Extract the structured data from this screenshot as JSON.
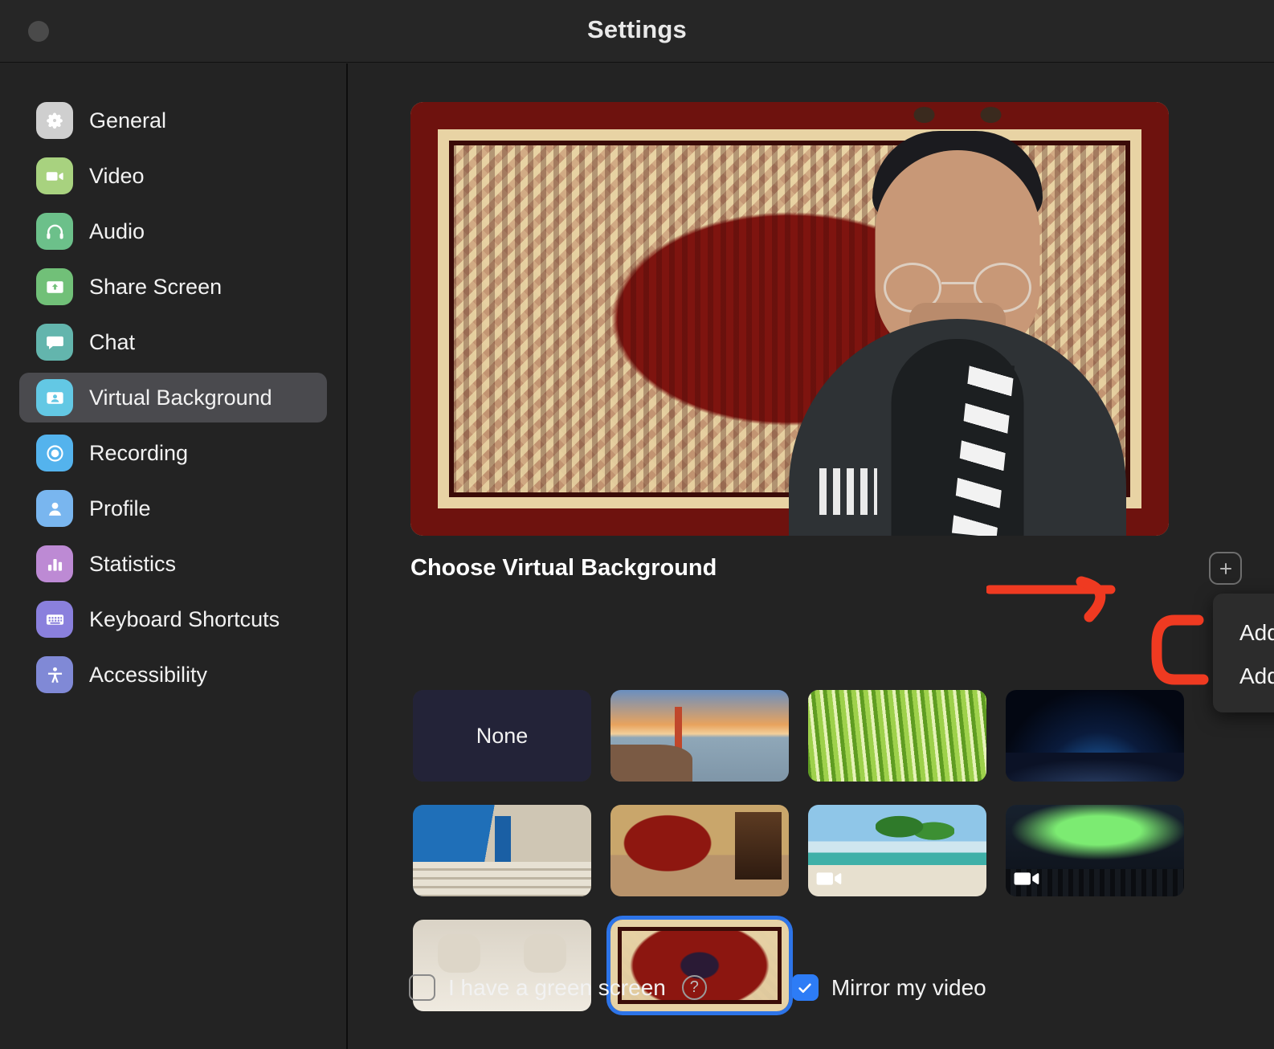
{
  "window": {
    "title": "Settings",
    "close_button": "close-window"
  },
  "sidebar": {
    "items": [
      {
        "label": "General",
        "icon": "gear-icon",
        "color": "#cfcfcf",
        "active": false
      },
      {
        "label": "Video",
        "icon": "video-camera-icon",
        "color": "#a8d27f",
        "active": false
      },
      {
        "label": "Audio",
        "icon": "headphones-icon",
        "color": "#6cc08a",
        "active": false
      },
      {
        "label": "Share Screen",
        "icon": "share-screen-icon",
        "color": "#71c078",
        "active": false
      },
      {
        "label": "Chat",
        "icon": "chat-bubble-icon",
        "color": "#63b5ad",
        "active": false
      },
      {
        "label": "Virtual Background",
        "icon": "person-card-icon",
        "color": "#63c8e4",
        "active": true
      },
      {
        "label": "Recording",
        "icon": "record-circle-icon",
        "color": "#54b3ed",
        "active": false
      },
      {
        "label": "Profile",
        "icon": "person-icon",
        "color": "#79b6ef",
        "active": false
      },
      {
        "label": "Statistics",
        "icon": "bar-chart-icon",
        "color": "#bd8ad4",
        "active": false
      },
      {
        "label": "Keyboard Shortcuts",
        "icon": "keyboard-icon",
        "color": "#8a80dd",
        "active": false
      },
      {
        "label": "Accessibility",
        "icon": "accessibility-icon",
        "color": "#8089d6",
        "active": false
      }
    ]
  },
  "main": {
    "preview_alt": "video-preview-with-carpet-background",
    "section_title": "Choose Virtual Background",
    "add_button_icon": "plus-icon",
    "dropdown": {
      "items": [
        "Add Image",
        "Add Video"
      ]
    },
    "backgrounds": [
      {
        "label": "None",
        "art": "a-none",
        "video": false,
        "selected": false
      },
      {
        "label": "",
        "art": "a-bridge",
        "video": false,
        "selected": false
      },
      {
        "label": "",
        "art": "a-grass",
        "video": false,
        "selected": false
      },
      {
        "label": "",
        "art": "a-space",
        "video": false,
        "selected": false
      },
      {
        "label": "",
        "art": "a-stairs",
        "video": false,
        "selected": false
      },
      {
        "label": "",
        "art": "a-room",
        "video": false,
        "selected": false
      },
      {
        "label": "",
        "art": "a-beach",
        "video": true,
        "selected": false
      },
      {
        "label": "",
        "art": "a-aurora",
        "video": true,
        "selected": false
      },
      {
        "label": "",
        "art": "a-car",
        "video": false,
        "selected": false
      },
      {
        "label": "",
        "art": "a-carpet",
        "video": false,
        "selected": true
      }
    ],
    "green_screen": {
      "label": "I have a green screen",
      "checked": false,
      "help_icon": "question-mark-icon",
      "help_glyph": "?"
    },
    "mirror_video": {
      "label": "Mirror my video",
      "checked": true
    }
  },
  "annotations": {
    "arrow_color": "#ef3a21",
    "arrow_name": "red-arrow-pointing-to-add-button",
    "bracket_name": "red-bracket-highlighting-add-image"
  },
  "colors": {
    "accent_blue": "#2d7cf6",
    "selection_blue": "#2d74e8",
    "annotation_red": "#ef3a21",
    "background": "#232323",
    "titlebar": "#262626"
  }
}
